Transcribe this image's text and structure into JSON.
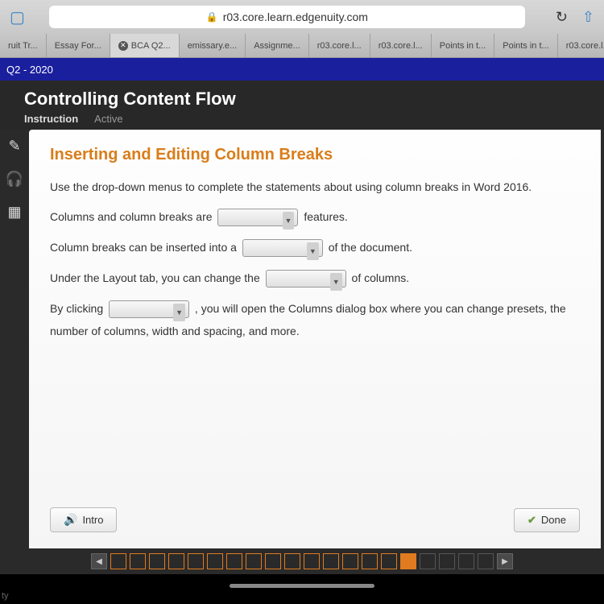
{
  "browser": {
    "url": "r03.core.learn.edgenuity.com",
    "tabs": [
      {
        "label": "ruit Tr..."
      },
      {
        "label": "Essay For..."
      },
      {
        "label": "BCA Q2...",
        "active": true,
        "closeable": true
      },
      {
        "label": "emissary.e..."
      },
      {
        "label": "Assignme..."
      },
      {
        "label": "r03.core.l..."
      },
      {
        "label": "r03.core.l..."
      },
      {
        "label": "Points in t..."
      },
      {
        "label": "Points in t..."
      },
      {
        "label": "r03.core.l..."
      }
    ]
  },
  "banner": "Q2 - 2020",
  "lesson": {
    "title": "Controlling Content Flow",
    "tab_primary": "Instruction",
    "tab_secondary": "Active"
  },
  "content": {
    "heading": "Inserting and Editing Column Breaks",
    "intro": "Use the drop-down menus to complete the statements about using column breaks in Word 2016.",
    "s1a": "Columns and column breaks are ",
    "s1b": " features.",
    "s2a": "Column breaks can be inserted into a ",
    "s2b": " of the document.",
    "s3a": "Under the Layout tab, you can change the ",
    "s3b": " of columns.",
    "s4a": "By clicking ",
    "s4b": " , you will open the Columns dialog box where you can change presets, the number of columns, width and spacing, and more."
  },
  "buttons": {
    "intro": "Intro",
    "done": "Done"
  },
  "corner": "ty"
}
